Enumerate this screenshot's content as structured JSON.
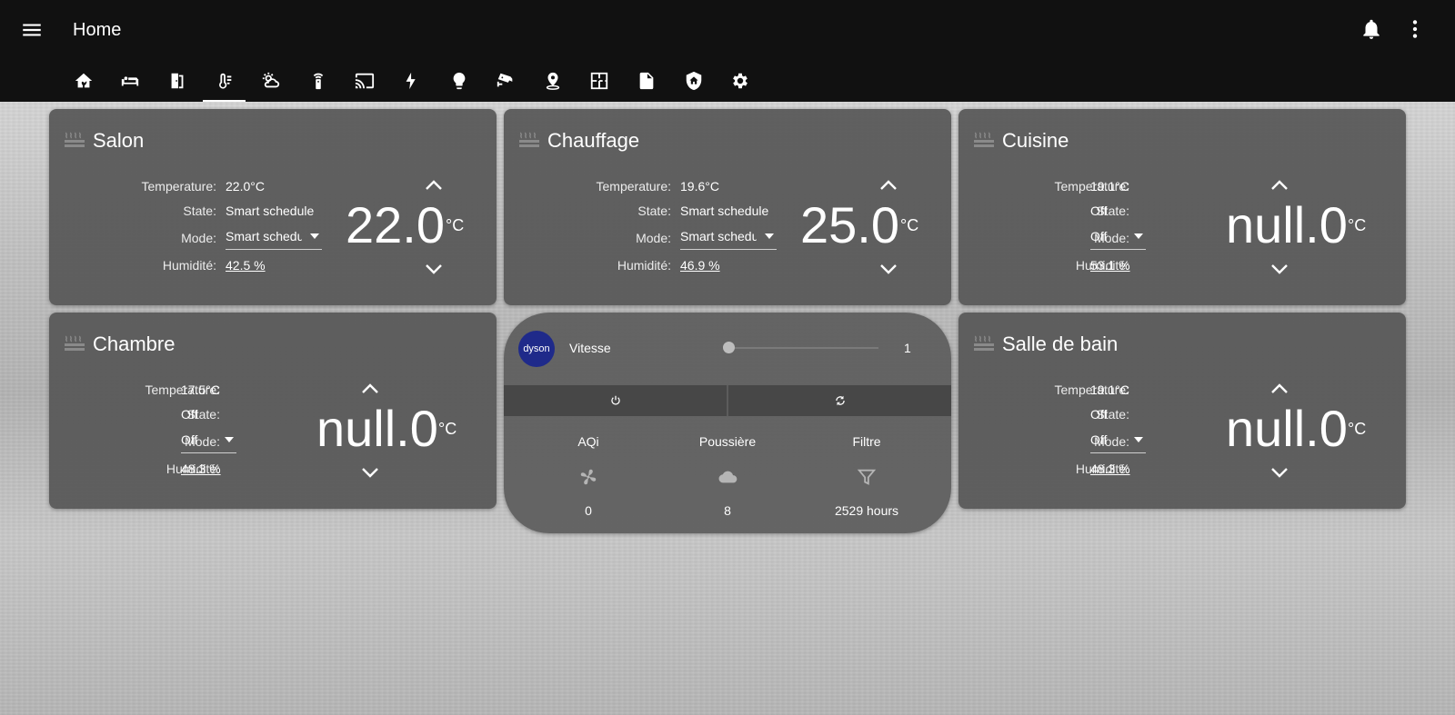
{
  "header": {
    "title": "Home",
    "icons": {
      "menu": "menu-icon",
      "bell": "bell-icon",
      "more": "more-vertical-icon"
    }
  },
  "tabs": [
    {
      "icon": "home-leaf-icon",
      "active": false
    },
    {
      "icon": "sofa-icon",
      "active": false
    },
    {
      "icon": "door-icon",
      "active": false
    },
    {
      "icon": "thermometer-icon",
      "active": true
    },
    {
      "icon": "weather-icon",
      "active": false
    },
    {
      "icon": "remote-icon",
      "active": false
    },
    {
      "icon": "cast-icon",
      "active": false
    },
    {
      "icon": "lightning-icon",
      "active": false
    },
    {
      "icon": "lightbulb-icon",
      "active": false
    },
    {
      "icon": "cctv-icon",
      "active": false
    },
    {
      "icon": "location-icon",
      "active": false
    },
    {
      "icon": "floor-plan-icon",
      "active": false
    },
    {
      "icon": "document-icon",
      "active": false
    },
    {
      "icon": "shield-home-icon",
      "active": false
    },
    {
      "icon": "settings-icon",
      "active": false
    }
  ],
  "labels": {
    "temperature": "Temperature:",
    "state": "State:",
    "mode": "Mode:",
    "humidity": "Humidité:",
    "unit": "°C"
  },
  "thermostats": {
    "salon": {
      "name": "Salon",
      "temperature": "22.0°C",
      "state": "Smart schedule",
      "mode": "Smart schedule",
      "humidity": "42.5 %",
      "setpoint": "22.0"
    },
    "chauffage": {
      "name": "Chauffage",
      "temperature": "19.6°C",
      "state": "Smart schedule",
      "mode": "Smart schedule",
      "humidity": "46.9 %",
      "setpoint": "25.0"
    },
    "cuisine": {
      "name": "Cuisine",
      "temperature": "19.1°C",
      "state": "Off",
      "mode": "Off",
      "humidity": "53.1 %",
      "setpoint": "null.0"
    },
    "chambre": {
      "name": "Chambre",
      "temperature": "17.5°C",
      "state": "Off",
      "mode": "Off",
      "humidity": "48.3 %",
      "setpoint": "null.0"
    },
    "salle_de_bain": {
      "name": "Salle de bain",
      "temperature": "19.1°C",
      "state": "Off",
      "mode": "Off",
      "humidity": "48.3 %",
      "setpoint": "null.0"
    }
  },
  "dyson": {
    "logo_text": "dyson",
    "speed_label": "Vitesse",
    "speed_value": "1",
    "stats": {
      "aqi": {
        "label": "AQi",
        "value": "0",
        "icon": "fan-icon"
      },
      "dust": {
        "label": "Poussière",
        "value": "8",
        "icon": "cloud-icon"
      },
      "filter": {
        "label": "Filtre",
        "value": "2529 hours",
        "icon": "filter-icon"
      }
    },
    "buttons": {
      "power": "power-icon",
      "oscillate": "sync-icon"
    }
  },
  "colors": {
    "header_bg": "#111111",
    "card_bg": "#585858",
    "dyson_logo": "#1f2a8a"
  }
}
